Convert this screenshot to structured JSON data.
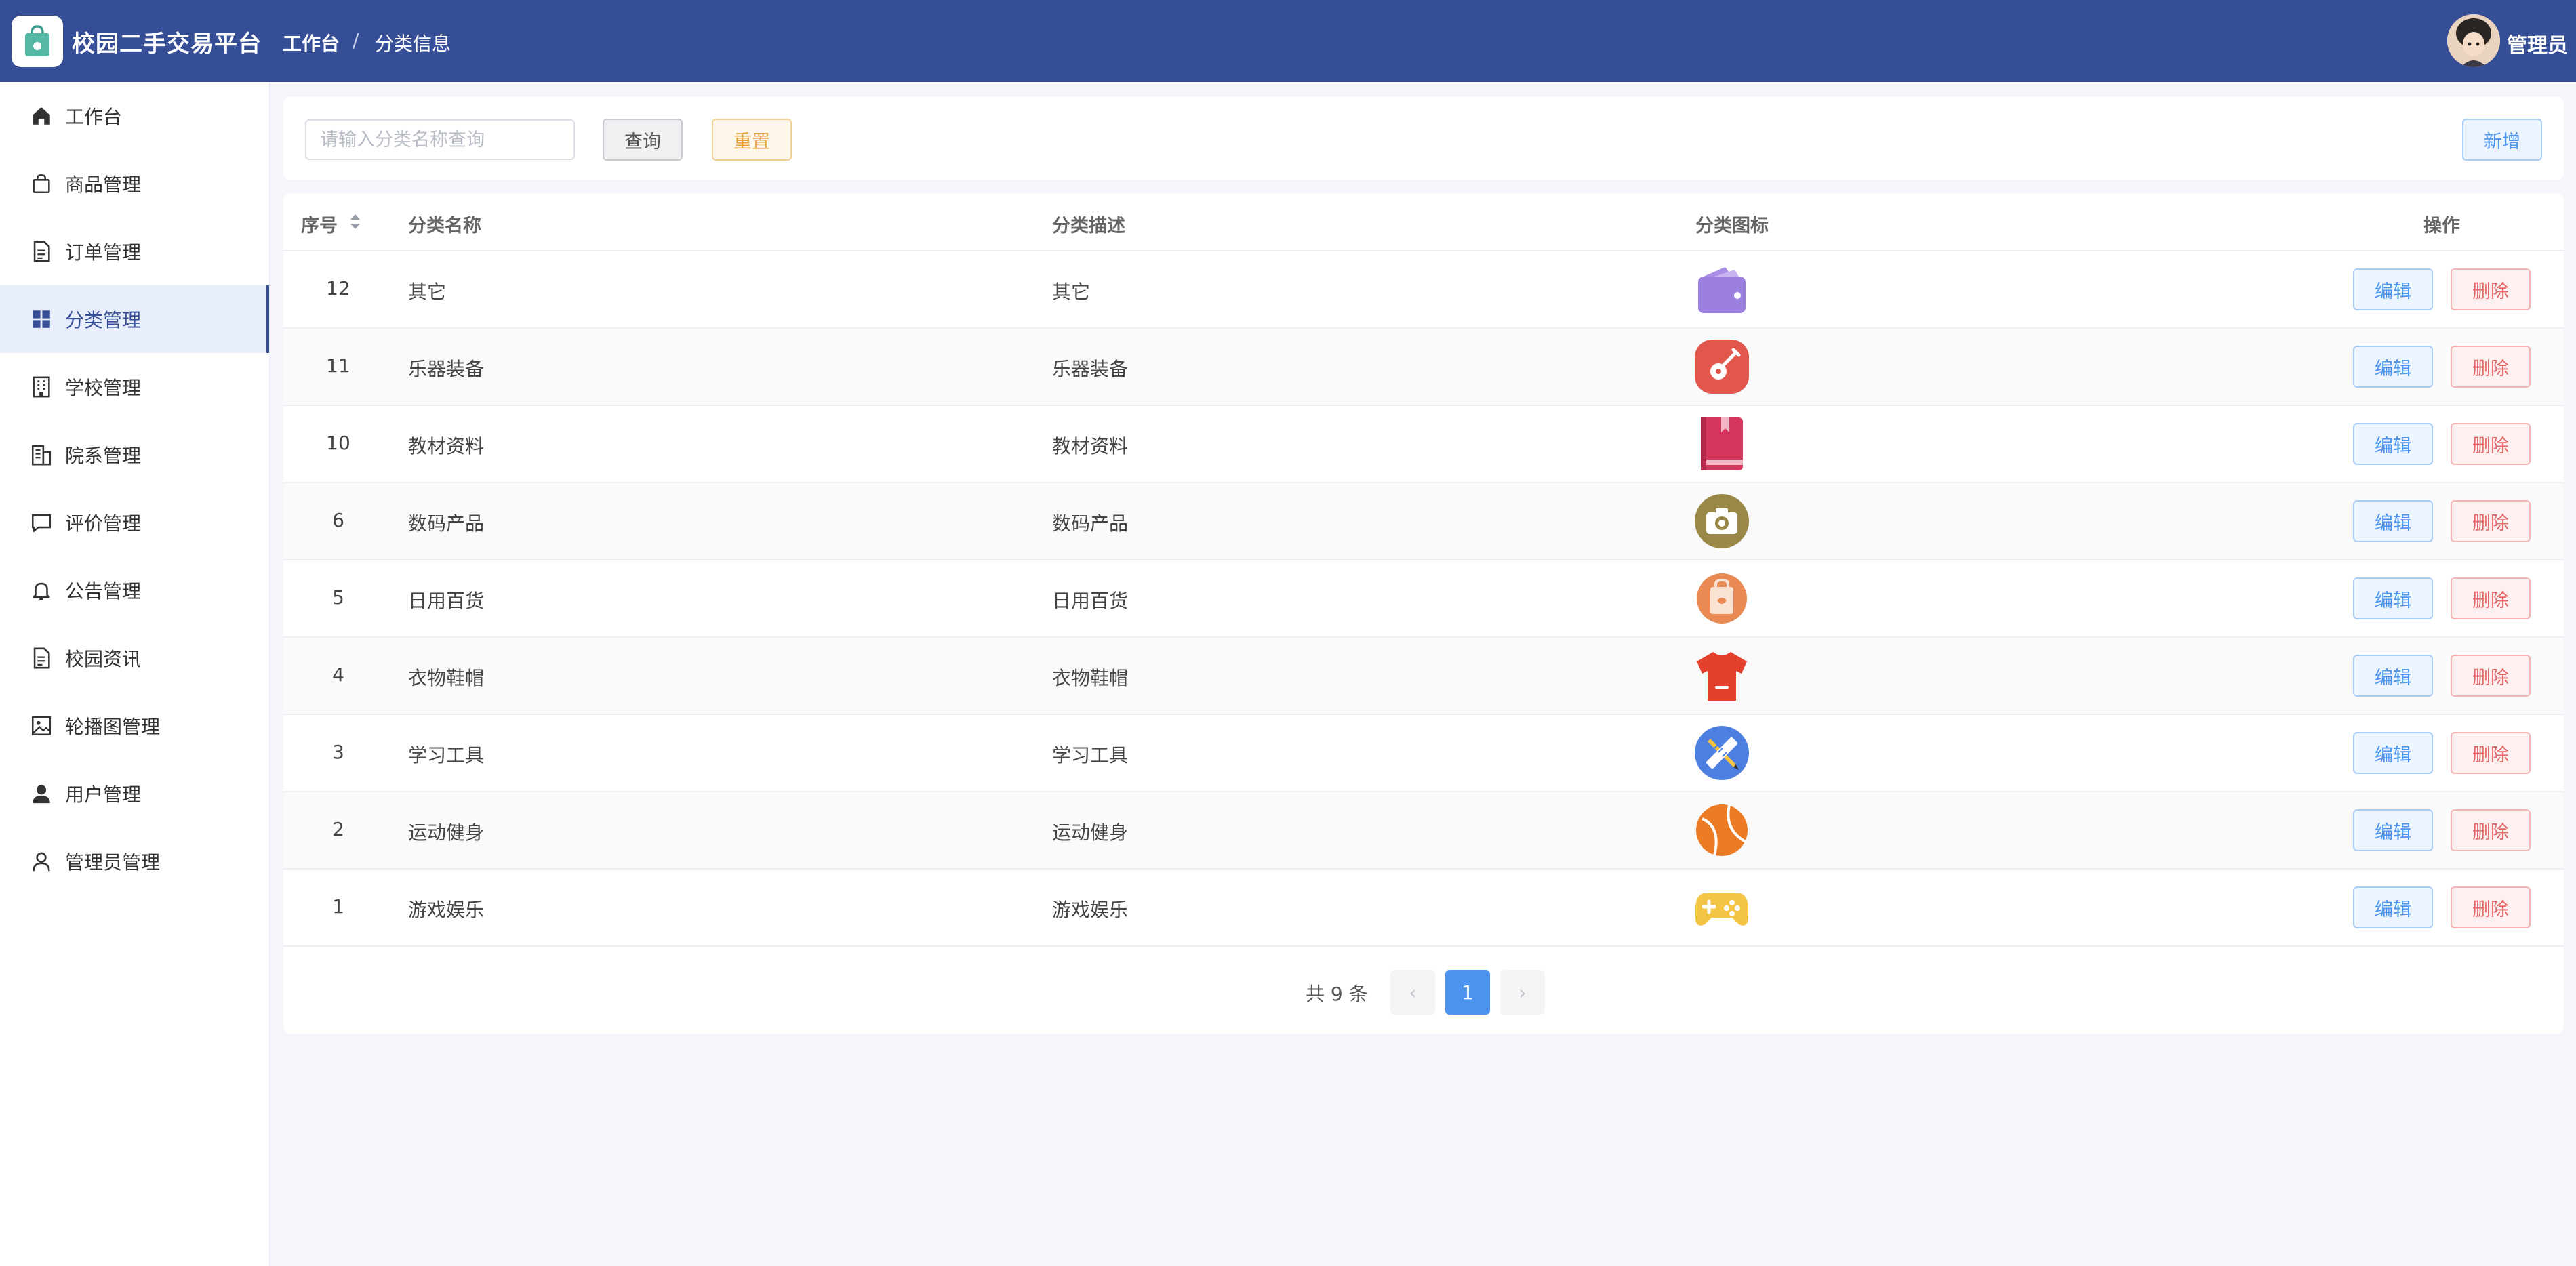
{
  "header": {
    "app_title": "校园二手交易平台",
    "breadcrumb": [
      "工作台",
      "分类信息"
    ],
    "breadcrumb_separator": "/",
    "user_name": "管理员",
    "bg_color": "#354e96"
  },
  "sidebar": {
    "items": [
      {
        "label": "工作台",
        "icon": "home-icon"
      },
      {
        "label": "商品管理",
        "icon": "bag-icon"
      },
      {
        "label": "订单管理",
        "icon": "document-icon"
      },
      {
        "label": "分类管理",
        "icon": "grid-icon",
        "active": true
      },
      {
        "label": "学校管理",
        "icon": "building-icon"
      },
      {
        "label": "院系管理",
        "icon": "office-icon"
      },
      {
        "label": "评价管理",
        "icon": "comment-icon"
      },
      {
        "label": "公告管理",
        "icon": "bell-icon"
      },
      {
        "label": "校园资讯",
        "icon": "document-icon"
      },
      {
        "label": "轮播图管理",
        "icon": "picture-icon"
      },
      {
        "label": "用户管理",
        "icon": "user-filled-icon"
      },
      {
        "label": "管理员管理",
        "icon": "user-icon"
      }
    ]
  },
  "search": {
    "placeholder": "请输入分类名称查询",
    "value": "",
    "query_label": "查询",
    "reset_label": "重置",
    "add_label": "新增"
  },
  "table": {
    "columns": {
      "id": "序号",
      "name": "分类名称",
      "desc": "分类描述",
      "icon": "分类图标",
      "actions": "操作"
    },
    "edit_label": "编辑",
    "delete_label": "删除",
    "rows": [
      {
        "id": "12",
        "name": "其它",
        "desc": "其它",
        "icon": "wallet-icon"
      },
      {
        "id": "11",
        "name": "乐器装备",
        "desc": "乐器装备",
        "icon": "guitar-icon"
      },
      {
        "id": "10",
        "name": "教材资料",
        "desc": "教材资料",
        "icon": "book-icon"
      },
      {
        "id": "6",
        "name": "数码产品",
        "desc": "数码产品",
        "icon": "camera-icon"
      },
      {
        "id": "5",
        "name": "日用百货",
        "desc": "日用百货",
        "icon": "shopping-bag-icon"
      },
      {
        "id": "4",
        "name": "衣物鞋帽",
        "desc": "衣物鞋帽",
        "icon": "shirt-icon"
      },
      {
        "id": "3",
        "name": "学习工具",
        "desc": "学习工具",
        "icon": "ruler-pencil-icon"
      },
      {
        "id": "2",
        "name": "运动健身",
        "desc": "运动健身",
        "icon": "basketball-icon"
      },
      {
        "id": "1",
        "name": "游戏娱乐",
        "desc": "游戏娱乐",
        "icon": "gamepad-icon"
      }
    ]
  },
  "pagination": {
    "total_text": "共 9 条",
    "current_page": "1",
    "prev": "‹",
    "next": "›"
  },
  "colors": {
    "primary": "#354e96",
    "edit": "#4c93ee",
    "delete": "#e36464",
    "reset": "#e4a23c"
  }
}
